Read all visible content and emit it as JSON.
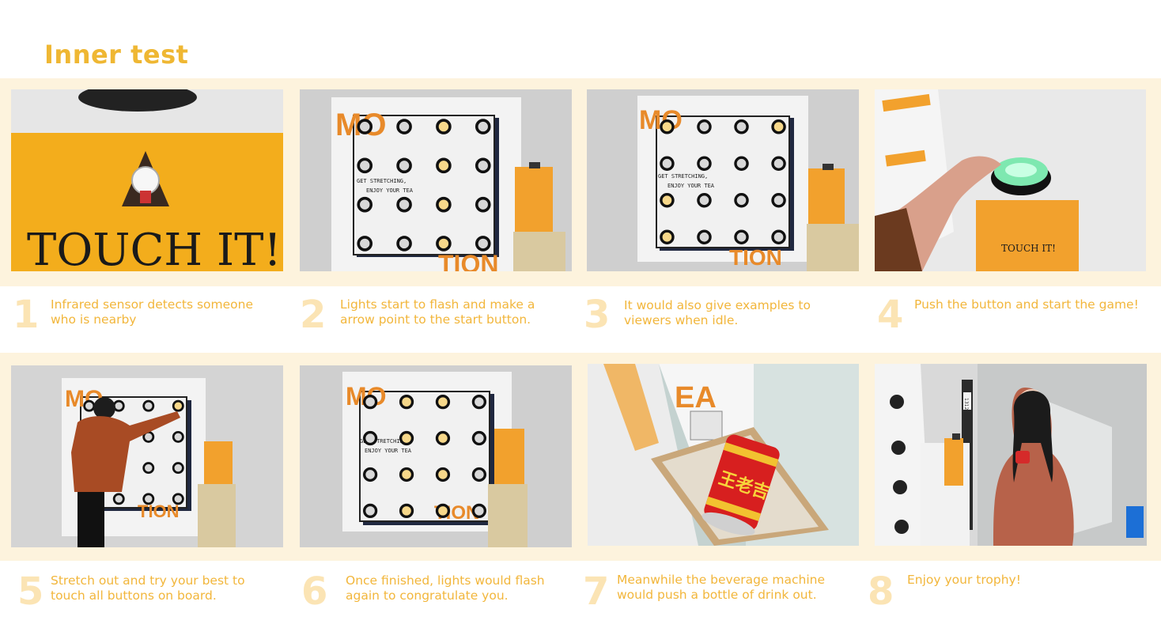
{
  "title": "Inner test",
  "colors": {
    "accent": "#efb733",
    "band": "#fdf3dd",
    "number": "#fbe4b4",
    "board_orange": "#e88a2a"
  },
  "board": {
    "letters_top": "MO",
    "letters_side": "EA",
    "letters_bottom": "TION",
    "text_line1": "GET STRETCHING,",
    "text_line2": "ENJOY YOUR TEA"
  },
  "touch_text": "TOUCH IT!",
  "can_text": "王老吉",
  "door_sign": "1312",
  "steps": [
    {
      "number": "1",
      "caption_line1": "Infrared sensor detects someone",
      "caption_line2": "who is nearby"
    },
    {
      "number": "2",
      "caption_line1": "Lights start to flash and make a",
      "caption_line2": "arrow point to the start button."
    },
    {
      "number": "3",
      "caption_line1": "It would also give examples to",
      "caption_line2": "viewers when idle."
    },
    {
      "number": "4",
      "caption_line1": "Push the button and start the game!",
      "caption_line2": ""
    },
    {
      "number": "5",
      "caption_line1": "Stretch out and try your best to",
      "caption_line2": "touch all buttons on board."
    },
    {
      "number": "6",
      "caption_line1": "Once finished, lights would flash",
      "caption_line2": "again to congratulate you."
    },
    {
      "number": "7",
      "caption_line1": "Meanwhile the beverage machine",
      "caption_line2": "would push a bottle of drink out."
    },
    {
      "number": "8",
      "caption_line1": "Enjoy your trophy!",
      "caption_line2": ""
    }
  ]
}
